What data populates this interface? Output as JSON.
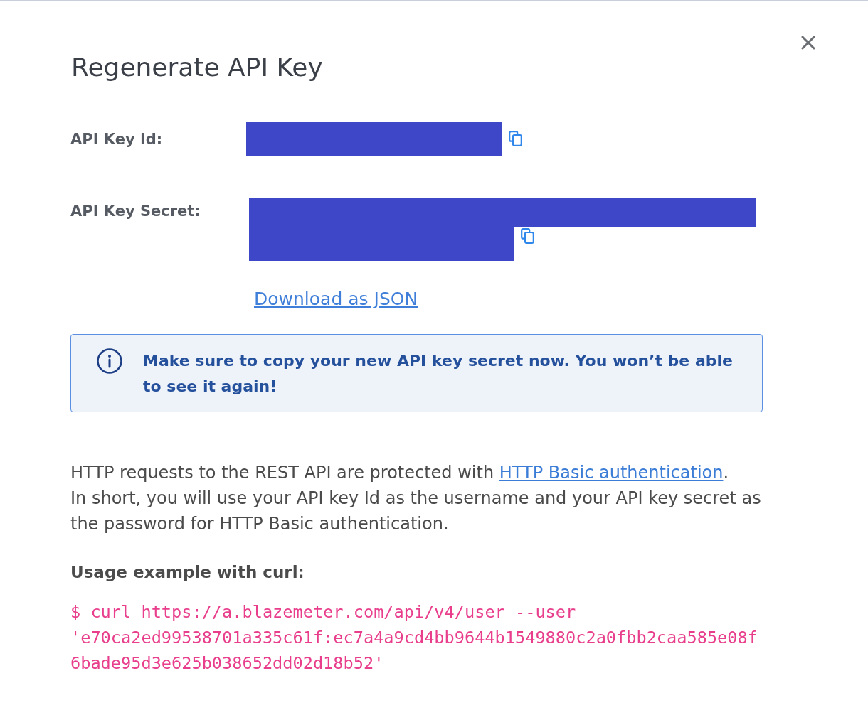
{
  "dialog": {
    "title": "Regenerate API Key"
  },
  "fields": [
    {
      "kind": "single_line",
      "label": "API Key Id:",
      "redacted": true
    },
    {
      "kind": "two_line",
      "label": "API Key Secret:",
      "redacted": true
    }
  ],
  "download_link": "Download as JSON",
  "notice": {
    "text": "Make sure to copy your new API key secret now. You won’t be able to see it again!"
  },
  "auth_text": {
    "before": "HTTP requests to the REST API are protected with ",
    "link": "HTTP Basic authentication",
    "after": ".",
    "detail": "In short, you will use your API key Id as the username and your API key secret as the password for HTTP Basic authentication."
  },
  "usage_heading": "Usage example with curl:",
  "code": "$ curl https://a.blazemeter.com/api/v4/user --user 'e70ca2ed99538701a335c61f:ec7a4a9cd4bb9644b1549880c2a0fbb2caa585e08f6bade95d3e625b038652dd02d18b52'"
}
